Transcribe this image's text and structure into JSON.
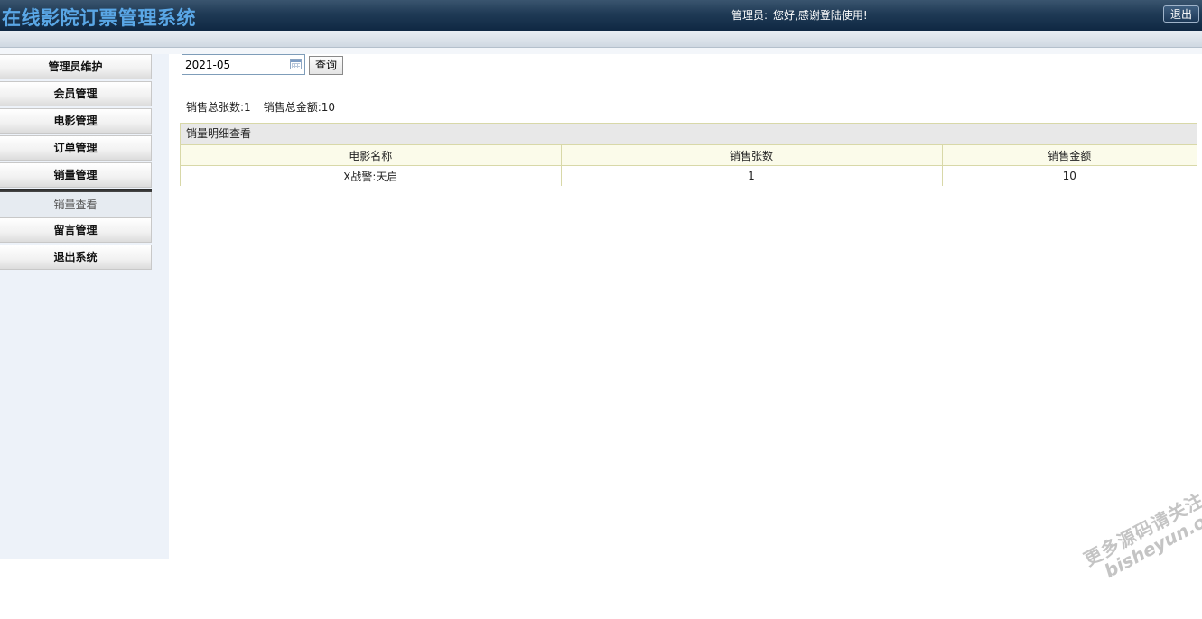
{
  "header": {
    "app_title": "在线影院订票管理系统",
    "role_label": "管理员:",
    "welcome_text": "您好,感谢登陆使用!",
    "logout_label": "退出"
  },
  "sidebar": {
    "items": [
      {
        "label": "管理员维护"
      },
      {
        "label": "会员管理"
      },
      {
        "label": "电影管理"
      },
      {
        "label": "订单管理"
      },
      {
        "label": "销量管理"
      },
      {
        "label": "留言管理"
      },
      {
        "label": "退出系统"
      }
    ],
    "submenu": {
      "label": "销量查看"
    }
  },
  "search": {
    "date_value": "2021-05",
    "query_label": "查询",
    "calendar_icon": "calendar-icon"
  },
  "summary": {
    "tickets_label": "销售总张数:",
    "tickets_value": "1",
    "amount_label": "销售总金额:",
    "amount_value": "10"
  },
  "detail": {
    "title": "销量明细查看",
    "columns": [
      "电影名称",
      "销售张数",
      "销售金额"
    ],
    "rows": [
      [
        "X战警:天启",
        "1",
        "10"
      ]
    ]
  },
  "watermark": {
    "line1": "更多源码请关注",
    "line2": "bisheyun.org"
  }
}
